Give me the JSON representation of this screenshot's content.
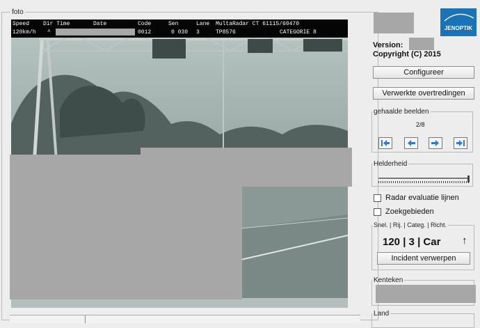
{
  "photo": {
    "legend": "foto",
    "overlay_header": [
      "Speed",
      "Dir Time",
      "Date",
      "Code",
      "Sen",
      "Lane",
      "MultaRadar CT 61115/60470"
    ],
    "overlay_values": [
      "120km/h",
      "^",
      "0012",
      "0 030",
      "3",
      "TP8576",
      "CATEGORIE 8"
    ]
  },
  "sidebar": {
    "logo_text": "JENOPTIK",
    "version_label": "Version:",
    "copyright": "Copyright (C) 2015",
    "configure_button": "Configureer",
    "processed_button": "Verwerkte overtredingen",
    "frames": {
      "legend": "gehaalde beelden",
      "counter": "2/8"
    },
    "brightness_legend": "Helderheid",
    "checkbox_radar": "Radar evaluatie lijnen",
    "checkbox_search": "Zoekgebieden",
    "speed_panel": {
      "legend": "Snel. | Rij. | Categ. | Richt.",
      "value": "120 | 3 | Car",
      "arrow": "↑",
      "reject_button": "Incident verwerpen"
    },
    "plate_legend": "Kenteken",
    "country_legend": "Land"
  },
  "colors": {
    "logo_bg": "#1a73b6",
    "nav_arrow": "#2b7bd1"
  }
}
